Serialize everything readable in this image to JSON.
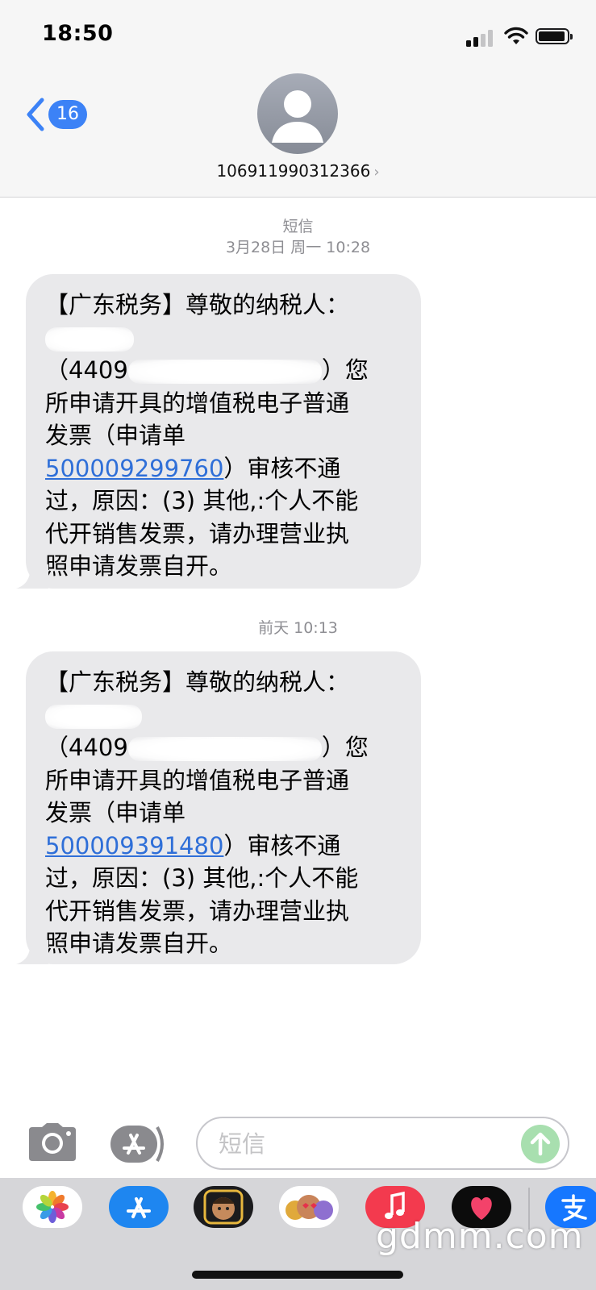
{
  "status_bar": {
    "time": "18:50"
  },
  "nav": {
    "unread_count": "16",
    "contact": "106911990312366",
    "chevron": "›"
  },
  "messages": [
    {
      "meta_line1": "短信",
      "meta_line2": "3月28日 周一 10:28",
      "lines": {
        "l1": "【广东税务】尊敬的纳税人：",
        "l3_start": "（4409",
        "l3_end": "）您",
        "l4": "所申请开具的增值税电子普通",
        "l5": "发票（申请单",
        "l6_link": "500009299760",
        "l6_rest": "）审核不通",
        "l7": "过，原因：(3) 其他,:个人不能",
        "l8": "代开销售发票，请办理营业执",
        "l9": "照申请发票自开。"
      }
    },
    {
      "meta_line1": "前天 10:13",
      "lines": {
        "l1": "【广东税务】尊敬的纳税人：",
        "l3_start": "（4409",
        "l3_end": "）您",
        "l4": "所申请开具的增值税电子普通",
        "l5": "发票（申请单",
        "l6_link": "500009391480",
        "l6_rest": "）审核不通",
        "l7": "过，原因：(3) 其他,:个人不能",
        "l8": "代开销售发票，请办理营业执",
        "l9": "照申请发票自开。"
      }
    }
  ],
  "compose": {
    "placeholder": "短信"
  },
  "watermark": "gdmm.com",
  "colors": {
    "accent": "#3c82f6",
    "bubble": "#e9e9eb",
    "link": "#2f6fd8",
    "send": "#a8dfaf"
  }
}
